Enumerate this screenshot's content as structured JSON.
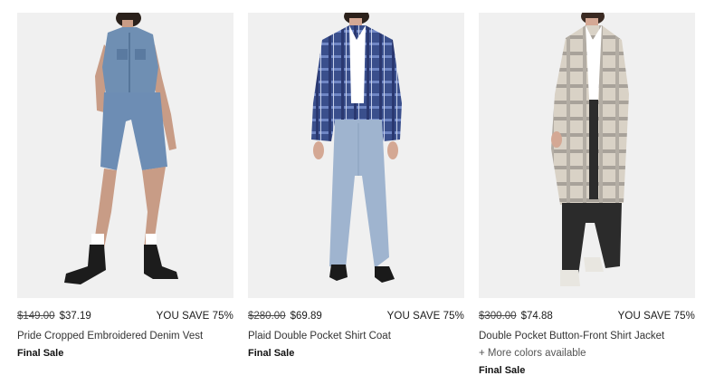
{
  "products": [
    {
      "image_alt": "model wearing denim vest and shorts",
      "price_original": "$149.00",
      "price_sale": "$37.19",
      "savings": "YOU SAVE 75%",
      "name": "Pride Cropped Embroidered Denim Vest",
      "more_colors": "",
      "final_sale": "Final Sale"
    },
    {
      "image_alt": "model wearing plaid shirt coat",
      "price_original": "$280.00",
      "price_sale": "$69.89",
      "savings": "YOU SAVE 75%",
      "name": "Plaid Double Pocket Shirt Coat",
      "more_colors": "",
      "final_sale": "Final Sale"
    },
    {
      "image_alt": "model wearing long plaid shirt jacket",
      "price_original": "$300.00",
      "price_sale": "$74.88",
      "savings": "YOU SAVE 75%",
      "name": "Double Pocket Button-Front Shirt Jacket",
      "more_colors": "+ More colors available",
      "final_sale": "Final Sale"
    }
  ],
  "colors": {
    "image_background": "#f0f0f0",
    "denim": "#6f8fb3",
    "plaid_blue": "#3a4f8c",
    "plaid_beige": "#d9d2c6"
  }
}
